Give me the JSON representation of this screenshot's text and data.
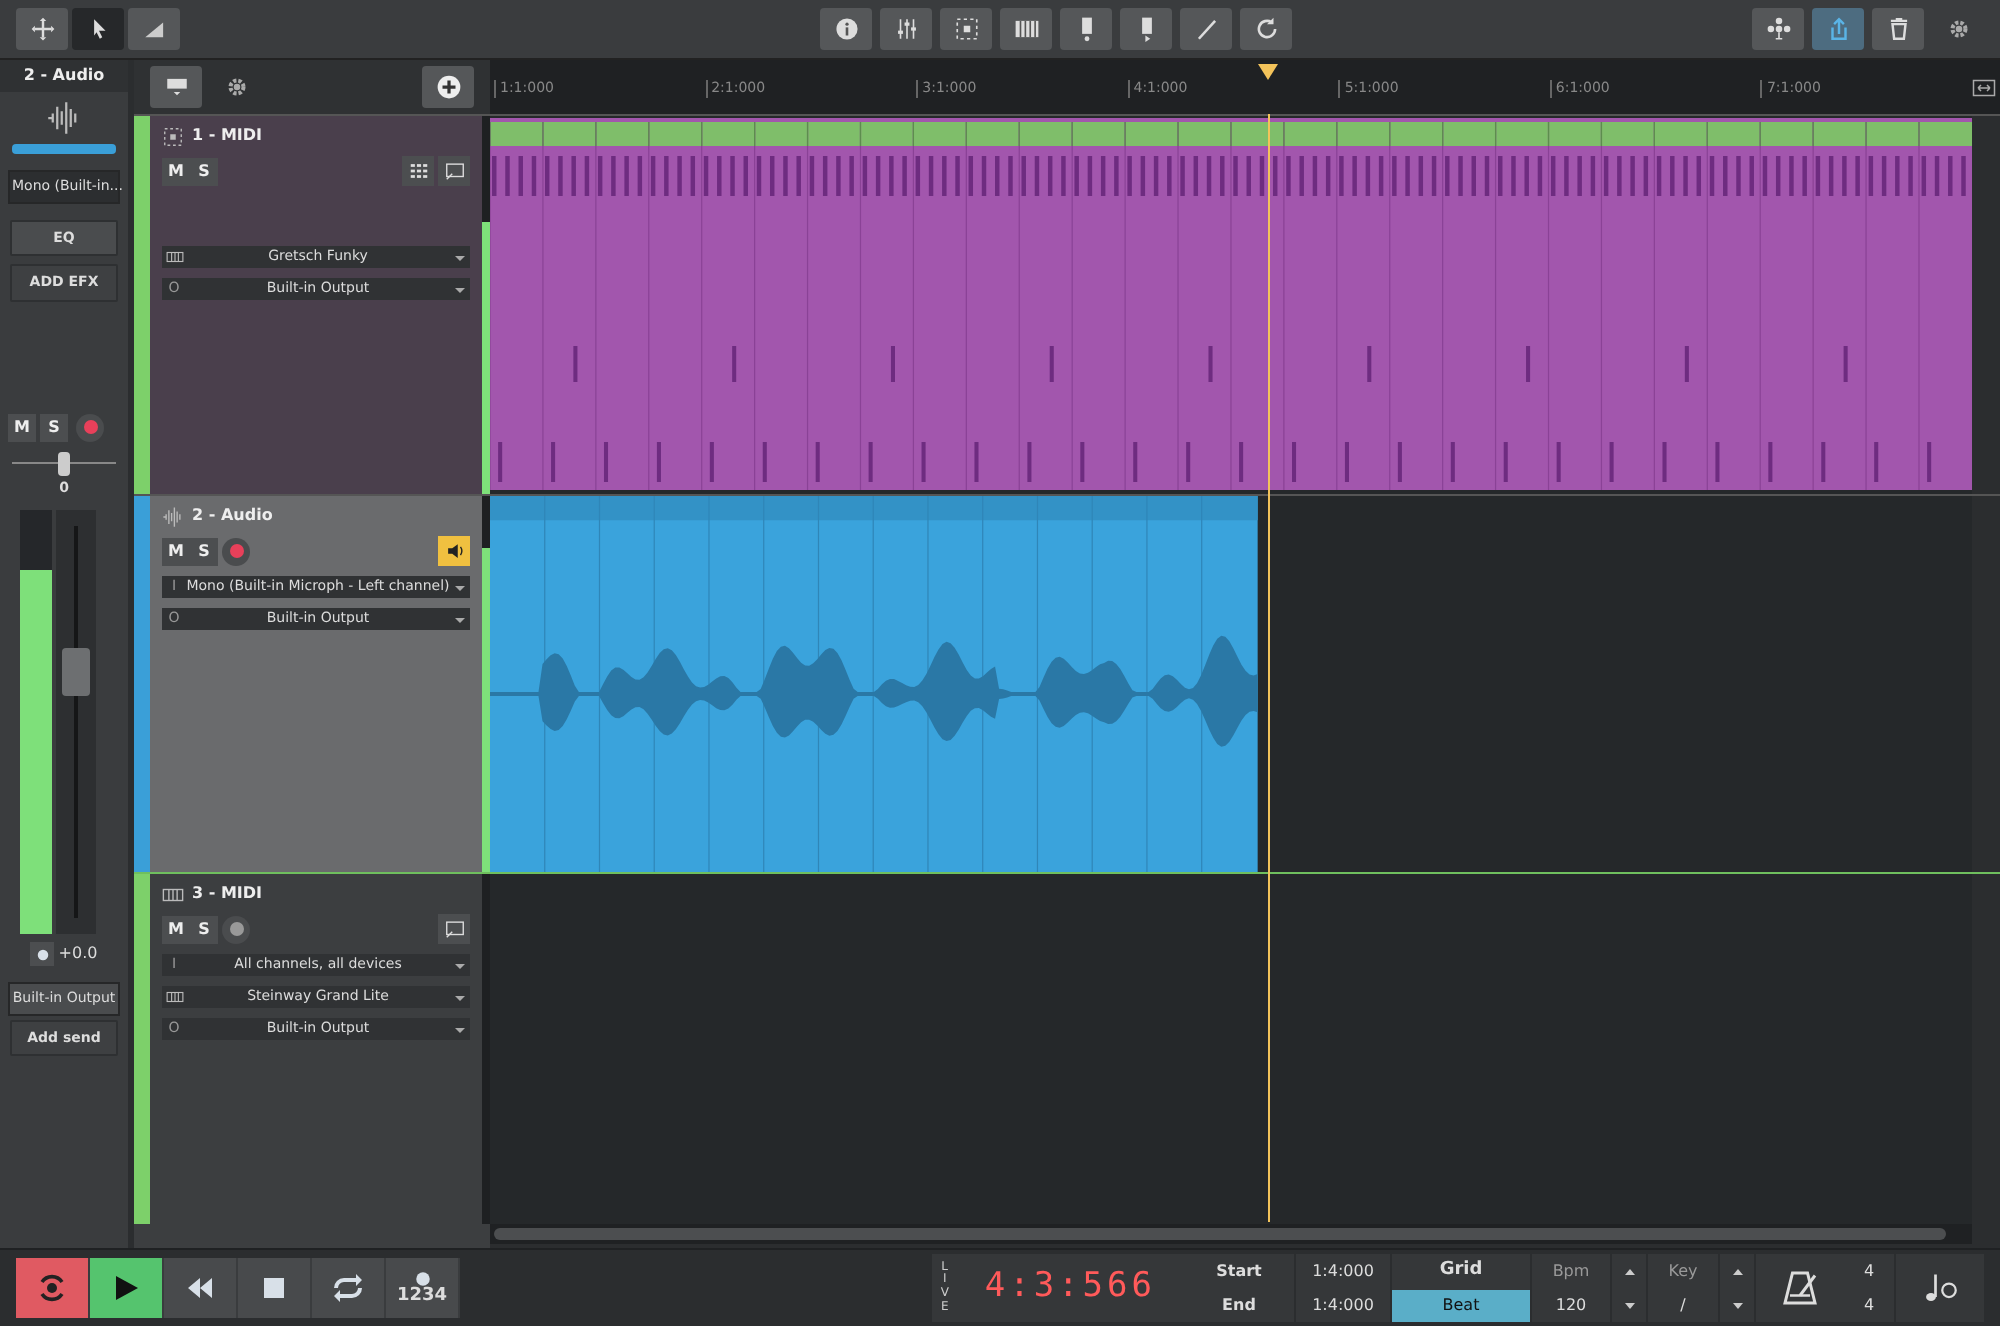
{
  "toolbar": {
    "left_tools": [
      {
        "kind": "move",
        "selected": false
      },
      {
        "kind": "pointer",
        "selected": true
      },
      {
        "kind": "ramp",
        "selected": false
      }
    ],
    "center_tools": [
      {
        "kind": "info"
      },
      {
        "kind": "sliders"
      },
      {
        "kind": "dots"
      },
      {
        "kind": "piano"
      },
      {
        "kind": "clip-down"
      },
      {
        "kind": "clip-play"
      },
      {
        "kind": "pen"
      },
      {
        "kind": "refresh"
      }
    ],
    "right_tools": [
      {
        "kind": "network",
        "on": false
      },
      {
        "kind": "share",
        "on": true
      },
      {
        "kind": "trash",
        "on": false
      }
    ]
  },
  "mixer": {
    "title": "2 - Audio",
    "input": "Mono (Built-in...",
    "eq": "EQ",
    "add_efx": "ADD EFX",
    "mute": {
      "label": "M",
      "on": false
    },
    "solo": {
      "label": "S",
      "on": false
    },
    "record": {
      "armed": true
    },
    "pan": {
      "level": 0.5,
      "reading": "0"
    },
    "meters": [
      {
        "level": 0.86
      },
      {
        "level": 0.86
      }
    ],
    "fader": {
      "level": 0.62
    },
    "gain": "+0.0",
    "output": "Built-in Output",
    "add_send": "Add send"
  },
  "ruler": {
    "marks": [
      "1:1:000",
      "2:1:000",
      "3:1:000",
      "4:1:000",
      "5:1:000",
      "6:1:000",
      "7:1:000"
    ]
  },
  "tracks": [
    {
      "name": "1 - MIDI",
      "kind": "midi",
      "color": "#7dd06a",
      "selected": false,
      "mute": {
        "label": "M",
        "on": false
      },
      "solo": {
        "label": "S",
        "on": false
      },
      "tools": [
        {
          "kind": "grid"
        },
        {
          "kind": "editor"
        }
      ],
      "routes": [
        {
          "kind": "instrument",
          "value": "Gretsch Funky"
        },
        {
          "kind": "output",
          "prefix": "O",
          "value": "Built-in Output"
        }
      ],
      "meter": {
        "level": 0.72
      },
      "clip": {
        "kind": "midi"
      }
    },
    {
      "name": "2 - Audio",
      "kind": "audio",
      "color": "#3a9fd8",
      "selected": true,
      "mute": {
        "label": "M",
        "on": false
      },
      "solo": {
        "label": "S",
        "on": false
      },
      "record": {
        "armed": true
      },
      "tools": [
        {
          "kind": "monitor",
          "on": true
        }
      ],
      "routes": [
        {
          "kind": "input",
          "prefix": "I",
          "value": "Mono (Built-in Microph - Left channel)"
        },
        {
          "kind": "output",
          "prefix": "O",
          "value": "Built-in Output"
        }
      ],
      "meter": {
        "level": 0.86
      },
      "clip": {
        "kind": "audio"
      }
    },
    {
      "name": "3 - MIDI",
      "kind": "midi",
      "color": "#7dd06a",
      "selected": false,
      "mute": {
        "label": "M",
        "on": false
      },
      "solo": {
        "label": "S",
        "on": false
      },
      "record": {
        "armed": false
      },
      "tools": [
        {
          "kind": "editor"
        }
      ],
      "routes": [
        {
          "kind": "input",
          "prefix": "I",
          "value": "All channels, all devices"
        },
        {
          "kind": "instrument",
          "value": "Steinway Grand Lite"
        },
        {
          "kind": "output",
          "prefix": "O",
          "value": "Built-in Output"
        }
      ],
      "meter": {
        "level": 0
      }
    }
  ],
  "transport": {
    "buttons": [
      {
        "kind": "loop-record",
        "on": true
      },
      {
        "kind": "play",
        "on": true
      },
      {
        "kind": "rewind",
        "on": false
      },
      {
        "kind": "stop",
        "on": false
      },
      {
        "kind": "loop",
        "on": false
      },
      {
        "kind": "count-in",
        "label": "1234",
        "on": false
      }
    ],
    "live": "LIVE",
    "time": "4:3:566",
    "start": {
      "label": "Start",
      "value": "1:4:000"
    },
    "end": {
      "label": "End",
      "value": "1:4:000"
    },
    "grid": {
      "label": "Grid",
      "value": "Beat"
    },
    "bpm": {
      "label": "Bpm",
      "value": "120"
    },
    "key": {
      "label": "Key",
      "value": "/"
    },
    "time_signature": {
      "numerator": "4",
      "denominator": "4"
    }
  }
}
